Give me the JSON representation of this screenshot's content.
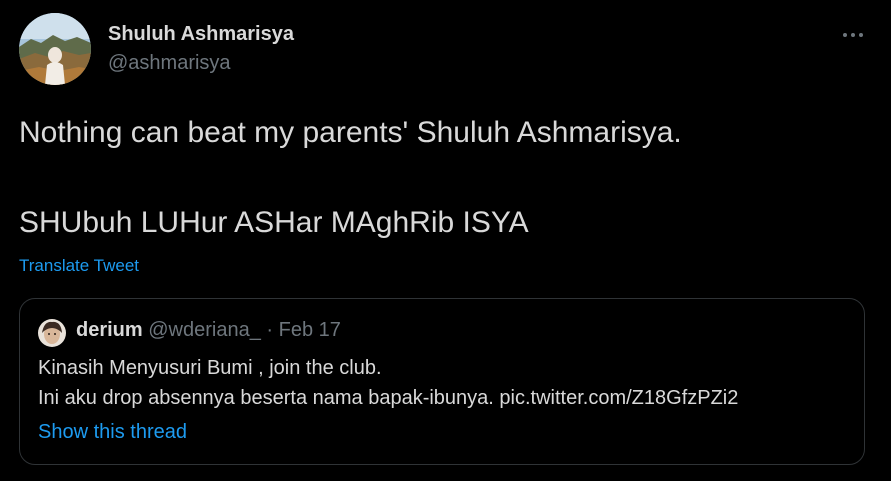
{
  "author": {
    "display_name": "Shuluh Ashmarisya",
    "handle": "@ashmarisya",
    "avatar_icon": "profile-photo-landscape"
  },
  "more_icon": "more-horizontal-icon",
  "tweet": {
    "line1": "Nothing can beat my parents' Shuluh Ashmarisya.",
    "line2": "SHUbuh LUHur ASHar MAghRib ISYA"
  },
  "translate_label": "Translate Tweet",
  "quoted": {
    "display_name": "derium",
    "handle": "@wderiana_",
    "separator": " · ",
    "date": "Feb 17",
    "line1": "Kinasih Menyusuri Bumi , join the club.",
    "line2": "Ini aku drop absennya beserta nama bapak-ibunya. pic.twitter.com/Z18GfzPZi2",
    "show_thread_label": "Show this thread",
    "avatar_icon": "profile-photo-face"
  },
  "colors": {
    "background": "#000000",
    "text": "#d9d9d9",
    "secondary": "#6e767d",
    "accent": "#1d9bf0",
    "border": "#2f3336"
  }
}
